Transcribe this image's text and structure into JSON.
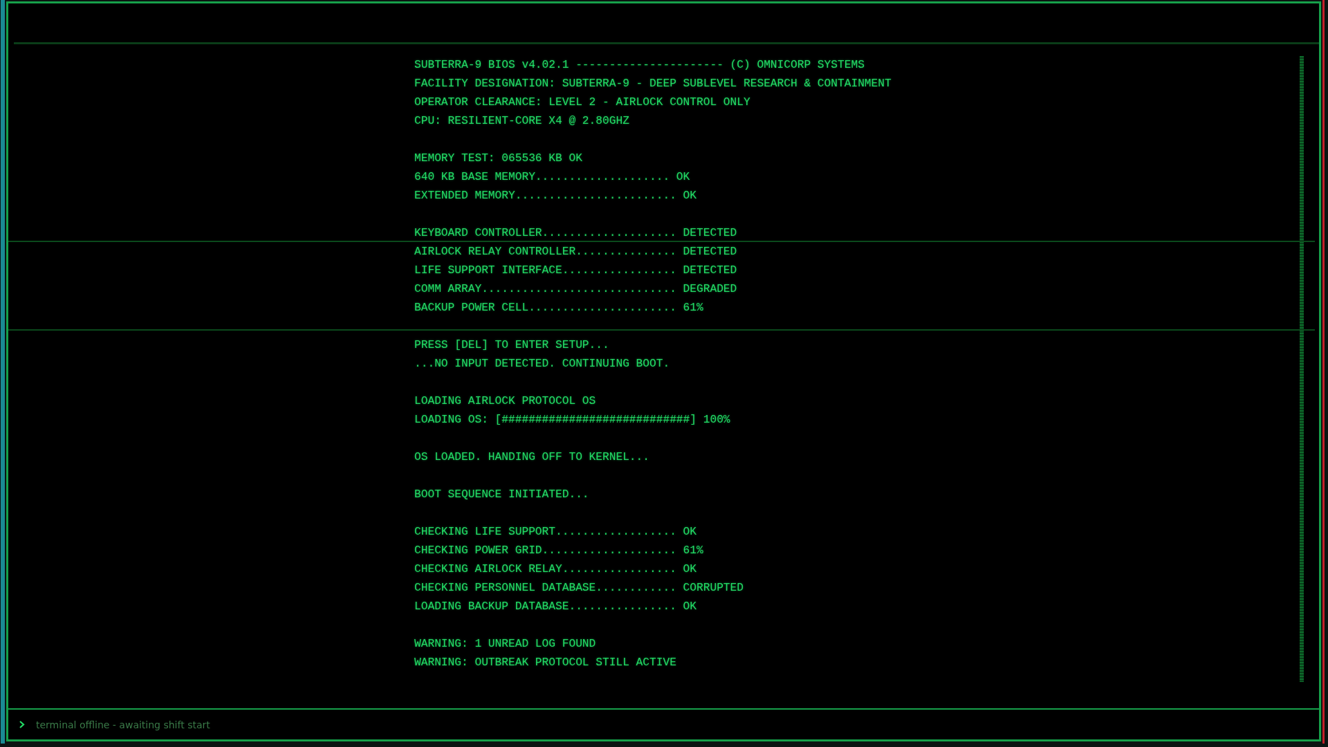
{
  "boot_log": [
    [
      "SUBTERRA-9 BIOS v4.02.1 ---------------------- (C) OMNICORP SYSTEMS",
      "FACILITY DESIGNATION: SUBTERRA-9 - DEEP SUBLEVEL RESEARCH & CONTAINMENT",
      "OPERATOR CLEARANCE: LEVEL 2 - AIRLOCK CONTROL ONLY",
      "CPU: RESILIENT-CORE X4 @ 2.80GHZ"
    ],
    [
      "MEMORY TEST: 065536 KB OK",
      "640 KB BASE MEMORY.................... OK",
      "EXTENDED MEMORY........................ OK"
    ],
    [
      "KEYBOARD CONTROLLER.................... DETECTED",
      "AIRLOCK RELAY CONTROLLER............... DETECTED",
      "LIFE SUPPORT INTERFACE................. DETECTED",
      "COMM ARRAY............................. DEGRADED",
      "BACKUP POWER CELL...................... 61%"
    ],
    [
      "PRESS [DEL] TO ENTER SETUP...",
      "...NO INPUT DETECTED. CONTINUING BOOT."
    ],
    [
      "LOADING AIRLOCK PROTOCOL OS",
      "LOADING OS: [############################] 100%"
    ],
    [
      "OS LOADED. HANDING OFF TO KERNEL..."
    ],
    [
      "BOOT SEQUENCE INITIATED..."
    ],
    [
      "CHECKING LIFE SUPPORT.................. OK",
      "CHECKING POWER GRID.................... 61%",
      "CHECKING AIRLOCK RELAY................. OK",
      "CHECKING PERSONNEL DATABASE............ CORRUPTED",
      "LOADING BACKUP DATABASE................ OK"
    ],
    [
      "WARNING: 1 UNREAD LOG FOUND",
      "WARNING: OUTBREAK PROTOCOL STILL ACTIVE"
    ]
  ],
  "prompt": {
    "placeholder": "terminal offline - awaiting shift start"
  }
}
